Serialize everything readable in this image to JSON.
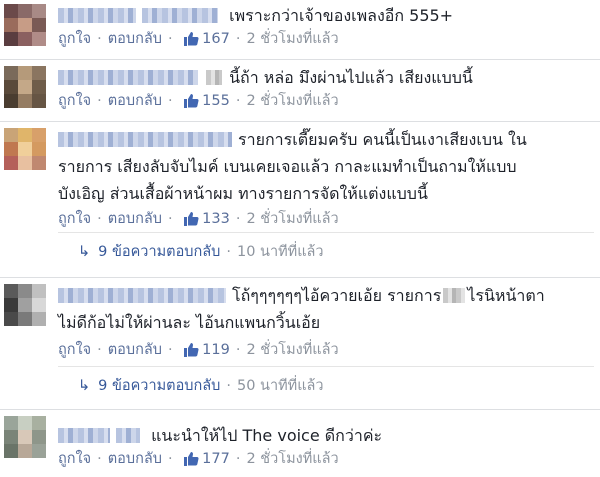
{
  "comments": [
    {
      "text": "เพราะกว่าเจ้าของเพลงอีก 555+",
      "like_label": "ถูกใจ",
      "reply_label": "ตอบกลับ",
      "likes": "167",
      "time": "2 ชั่วโมงที่แล้ว"
    },
    {
      "text": "นี้ถ้า หล่อ มึงผ่านไปแล้ว เสียงแบบนี้",
      "like_label": "ถูกใจ",
      "reply_label": "ตอบกลับ",
      "likes": "155",
      "time": "2 ชั่วโมงที่แล้ว"
    },
    {
      "text_line1": "รายการเตี๊ยมครับ คนนี้เป็นเงาเสียงเบน ใน",
      "text_line2": "รายการ เสียงลับจับไมค์ เบนเคยเจอแล้ว กาละแมทำเป็นถามให้แบบ",
      "text_line3": "บังเอิญ ส่วนเสื้อผ้าหน้าผม ทางรายการจัดให้แต่งแบบนี้",
      "like_label": "ถูกใจ",
      "reply_label": "ตอบกลับ",
      "likes": "133",
      "time": "2 ชั่วโมงที่แล้ว",
      "replies_label": "9 ข้อความตอบกลับ",
      "replies_time": "10 นาทีที่แล้ว"
    },
    {
      "text_line1_a": "โถ้ๆๆๆๆๆๆไอ้ควายเอ้ย รายการ",
      "text_line1_b": "ไรนิหน้าตา",
      "text_line2": "ไม่ดีก้อไม่ให้ผ่านละ ไอ้นกแพนกวิ้นเอ้ย",
      "like_label": "ถูกใจ",
      "reply_label": "ตอบกลับ",
      "likes": "119",
      "time": "2 ชั่วโมงที่แล้ว",
      "replies_label": "9 ข้อความตอบกลับ",
      "replies_time": "50 นาทีที่แล้ว"
    },
    {
      "text": "แนะนำให้ไป The voice ดีกว่าค่ะ",
      "like_label": "ถูกใจ",
      "reply_label": "ตอบกลับ",
      "likes": "177",
      "time": "2 ชั่วโมงที่แล้ว"
    }
  ],
  "colors": {
    "link": "#365899",
    "meta": "#8d949e",
    "like_icon": "#4267b2"
  },
  "icons": {
    "like": "thumbs-up-icon",
    "reply_arrow": "reply-arrow-icon"
  }
}
